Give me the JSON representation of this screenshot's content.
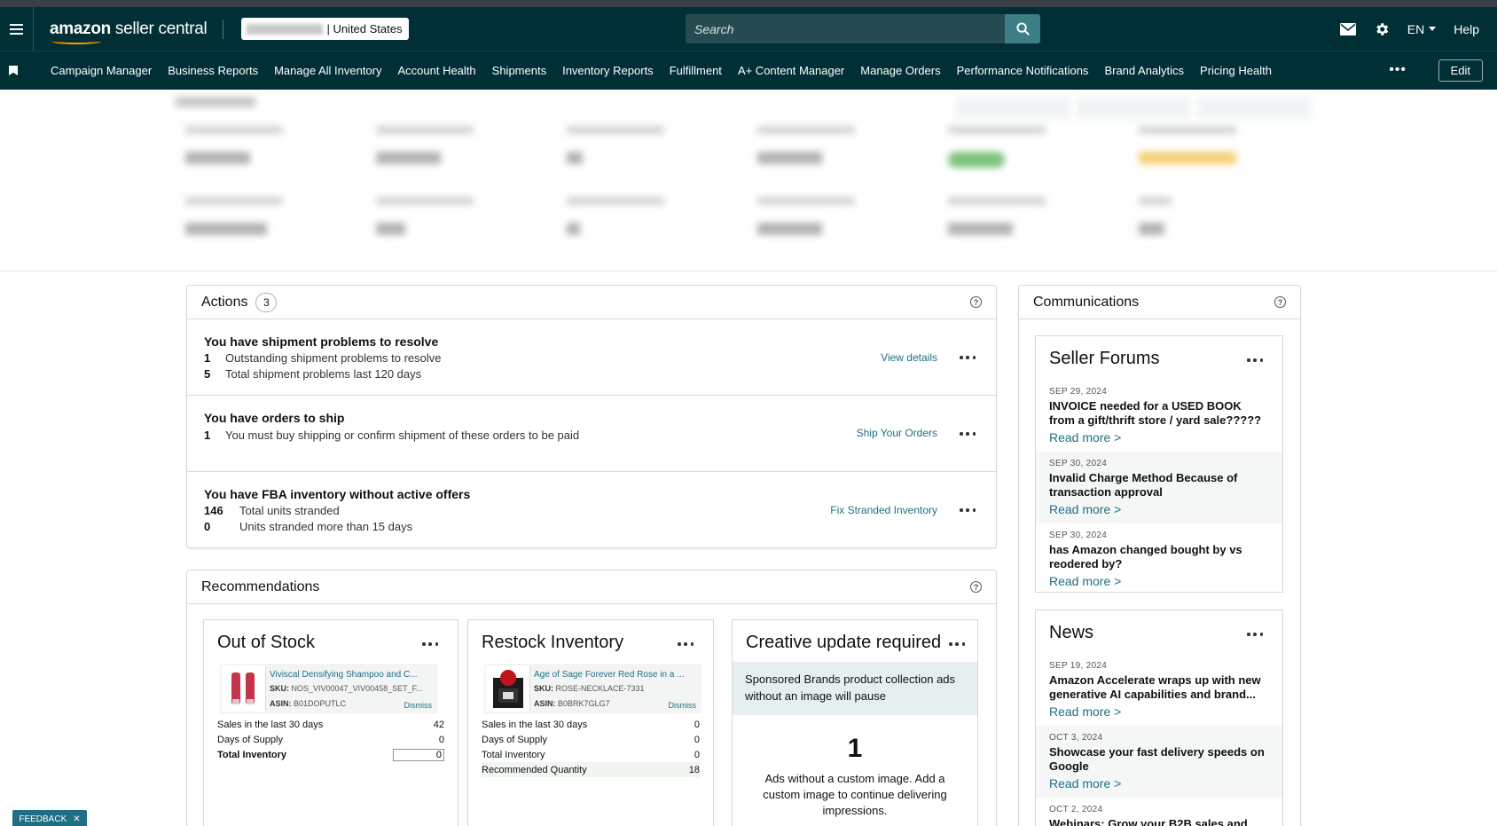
{
  "app": {
    "logo_bold": "amazon",
    "logo_rest": " seller central",
    "marketplace": "| United States"
  },
  "topbar": {
    "search_placeholder": "Search",
    "lang": "EN",
    "help": "Help"
  },
  "nav": {
    "items": [
      "Campaign Manager",
      "Business Reports",
      "Manage All Inventory",
      "Account Health",
      "Shipments",
      "Inventory Reports",
      "Fulfillment",
      "A+ Content Manager",
      "Manage Orders",
      "Performance Notifications",
      "Brand Analytics",
      "Pricing Health"
    ],
    "more": "•••",
    "edit": "Edit"
  },
  "actions": {
    "title": "Actions",
    "count": "3",
    "rows": [
      {
        "title": "You have shipment problems to resolve",
        "lines": [
          {
            "num": "1",
            "text": "Outstanding shipment problems to resolve"
          },
          {
            "num": "5",
            "text": "Total shipment problems last 120 days"
          }
        ],
        "link": "View details"
      },
      {
        "title": "You have orders to ship",
        "lines": [
          {
            "num": "1",
            "text": "You must buy shipping or confirm shipment of these orders to be paid"
          }
        ],
        "link": "Ship Your Orders"
      },
      {
        "title": "You have FBA inventory without active offers",
        "lines": [
          {
            "num": "146",
            "text": "Total units stranded"
          },
          {
            "num": "0",
            "text": "Units stranded more than 15 days"
          }
        ],
        "link": "Fix Stranded Inventory"
      }
    ]
  },
  "recommendations": {
    "title": "Recommendations",
    "out_of_stock": {
      "title": "Out of Stock",
      "product_name": "Viviscal Densifying Shampoo and C...",
      "sku_label": "SKU:",
      "sku": "NOS_VIV00047_VIV00458_SET_F...",
      "asin_label": "ASIN:",
      "asin": "B01DOPUTLC",
      "dismiss": "Dismiss",
      "stats": [
        {
          "label": "Sales in the last 30 days",
          "value": "42"
        },
        {
          "label": "Days of Supply",
          "value": "0"
        }
      ],
      "total_label": "Total Inventory",
      "total_value": "0"
    },
    "restock": {
      "title": "Restock Inventory",
      "product_name": "Age of Sage Forever Red Rose in a ...",
      "sku_label": "SKU:",
      "sku": "ROSE-NECKLACE-7331",
      "asin_label": "ASIN:",
      "asin": "B0BRK7GLG7",
      "dismiss": "Dismiss",
      "stats": [
        {
          "label": "Sales in the last 30 days",
          "value": "0"
        },
        {
          "label": "Days of Supply",
          "value": "0"
        },
        {
          "label": "Total Inventory",
          "value": "0"
        },
        {
          "label": "Recommended Quantity",
          "value": "18"
        }
      ]
    },
    "creative": {
      "title": "Creative update required",
      "notice": "Sponsored Brands product collection ads without an image will pause",
      "count": "1",
      "text": "Ads without a custom image. Add a custom image to continue delivering impressions."
    }
  },
  "communications": {
    "title": "Communications",
    "forums": {
      "title": "Seller Forums",
      "items": [
        {
          "date": "SEP 29, 2024",
          "title": "INVOICE needed for a USED BOOK from a gift/thrift store / yard sale?????",
          "read": "Read more >"
        },
        {
          "date": "SEP 30, 2024",
          "title": "Invalid Charge Method Because of transaction approval",
          "read": "Read more >"
        },
        {
          "date": "SEP 30, 2024",
          "title": "has Amazon changed bought by vs reodered by?",
          "read": "Read more >"
        }
      ]
    },
    "news": {
      "title": "News",
      "items": [
        {
          "date": "SEP 19, 2024",
          "title": "Amazon Accelerate wraps up with new generative AI capabilities and brand...",
          "read": "Read more >"
        },
        {
          "date": "OCT 3, 2024",
          "title": "Showcase your fast delivery speeds on Google",
          "read": "Read more >"
        },
        {
          "date": "OCT 2, 2024",
          "title": "Webinars: Grow your B2B sales and",
          "read": ""
        }
      ]
    }
  },
  "feedback": {
    "label": "FEEDBACK",
    "close": "✕"
  },
  "colors": {
    "header_bg": "#002f36",
    "link": "#1f6f84",
    "accent": "#ff9900"
  }
}
